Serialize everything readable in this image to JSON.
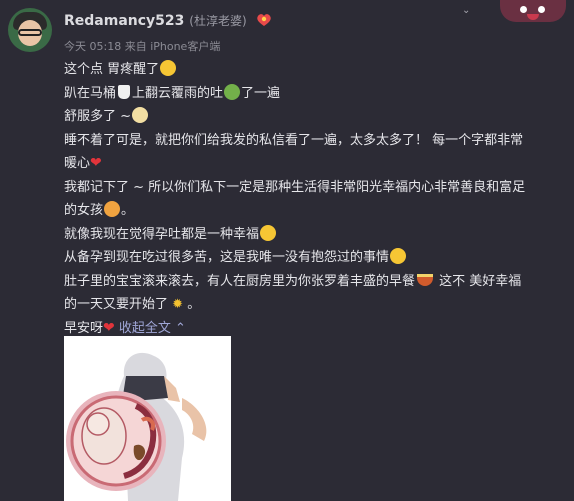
{
  "user": {
    "name": "Redamancy523",
    "note": "(杜淳老婆)",
    "badge_icon": "vip-badge-icon"
  },
  "meta": {
    "time": "今天 05:18",
    "source": "来自 iPhone客户端"
  },
  "post": {
    "l1": "这个点 胃疼醒了",
    "l2a": "趴在马桶",
    "l2b": "上翻云覆雨的吐",
    "l2c": "了一遍",
    "l3": "舒服多了 ~",
    "l4a": "睡不着了可是，就把你们给我发的私信看了一遍，太多太多了！ 每一个字都非常",
    "l4b": "暖心",
    "l5a": "我都记下了 ~ 所以你们私下一定是那种生活得非常阳光幸福内心非常善良和富足",
    "l5b": "的女孩",
    "l5c": "。",
    "l6": "就像我现在觉得孕吐都是一种幸福",
    "l7": "从备孕到现在吃过很多苦，这是我唯一没有抱怨过的事情",
    "l8a": "肚子里的宝宝滚来滚去，有人在厨房里为你张罗着丰盛的早餐",
    "l8b": " 这不 美好幸福",
    "l9a": "的一天又要开始了",
    "l9b": "。",
    "l10": "早安呀",
    "collapse": "收起全文",
    "collapse_arrow": "⌃"
  },
  "icons": {
    "heart": "❤",
    "sun": "✹",
    "menu": "⌄"
  },
  "colors": {
    "background": "#2c2b35",
    "text": "#e6e6ea",
    "link": "#9fa6d6",
    "heart": "#e2343b"
  }
}
